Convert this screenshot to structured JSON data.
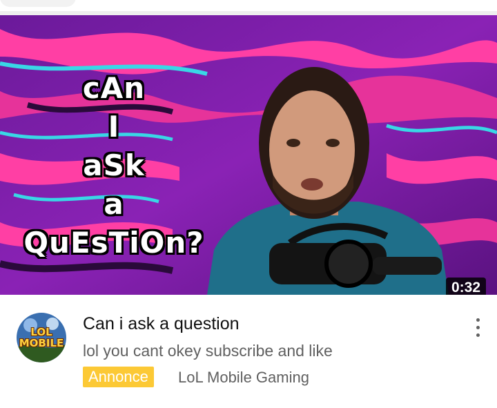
{
  "video": {
    "thumbnail_text": [
      "cAn",
      "I",
      "aSk",
      "a",
      "QuEsTiOn?"
    ],
    "duration": "0:32",
    "title": "Can i ask a question",
    "description": "lol you cant okey subscribe and like",
    "badge": "Annonce",
    "channel": "LoL Mobile Gaming",
    "avatar_text": [
      "LOL",
      "MOBILE"
    ]
  },
  "icons": {
    "menu": "more-vert-icon"
  },
  "colors": {
    "badge": "#fcc935",
    "secondary_text": "#606060",
    "title_text": "#0f0f0f",
    "thumb_purple": "#7a1fa8",
    "thumb_pink": "#ff3fa4",
    "thumb_cyan": "#39d7e6"
  }
}
